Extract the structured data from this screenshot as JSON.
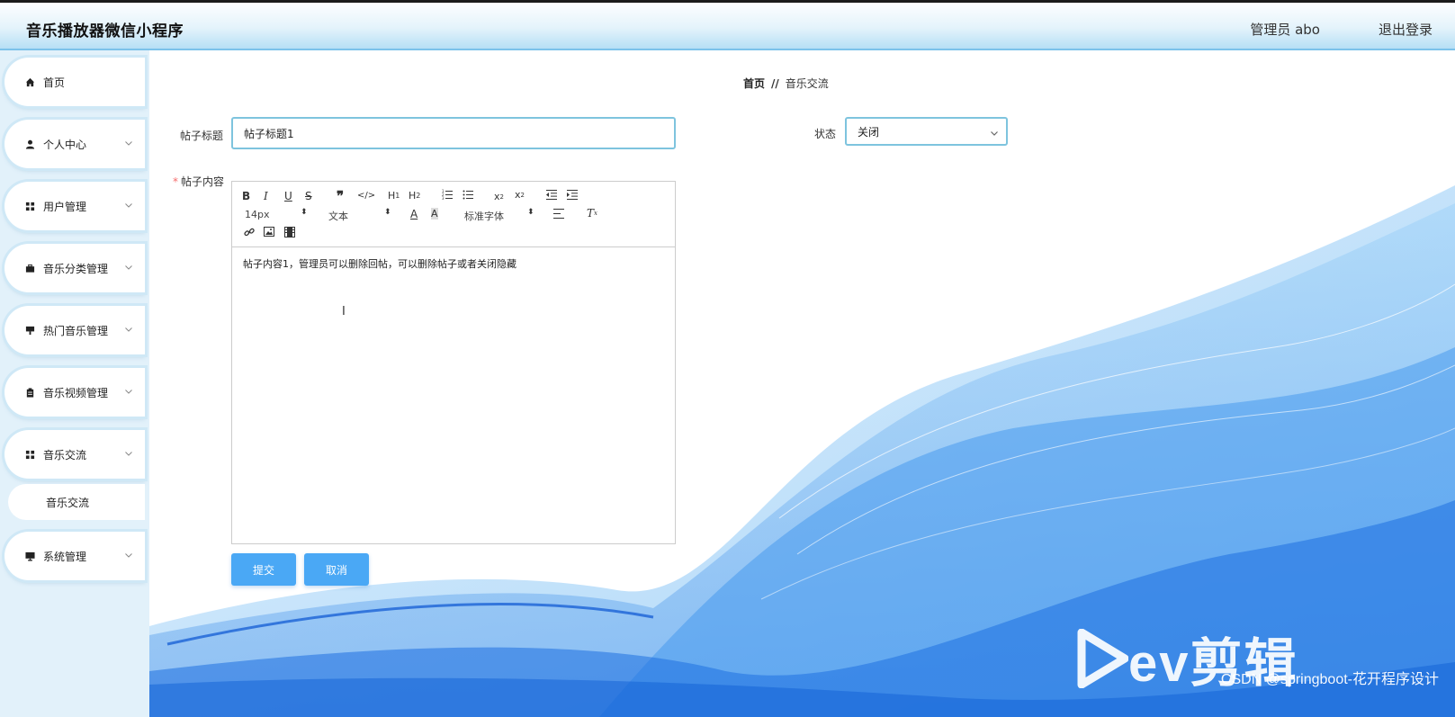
{
  "header": {
    "app_title": "音乐播放器微信小程序",
    "user_label": "管理员 abo",
    "logout_label": "退出登录"
  },
  "sidebar": {
    "items": [
      {
        "label": "首页",
        "icon": "home-icon"
      },
      {
        "label": "个人中心",
        "icon": "user-icon"
      },
      {
        "label": "用户管理",
        "icon": "grid-icon"
      },
      {
        "label": "音乐分类管理",
        "icon": "briefcase-icon"
      },
      {
        "label": "热门音乐管理",
        "icon": "flag-icon"
      },
      {
        "label": "音乐视频管理",
        "icon": "clipboard-icon"
      },
      {
        "label": "音乐交流",
        "icon": "grid-icon"
      },
      {
        "label": "系统管理",
        "icon": "monitor-icon"
      }
    ],
    "submenu_label": "音乐交流"
  },
  "breadcrumb": {
    "home": "首页",
    "separator": "//",
    "current": "音乐交流"
  },
  "form": {
    "title_label": "帖子标题",
    "title_value": "帖子标题1",
    "status_label": "状态",
    "status_value": "关闭",
    "content_label": "帖子内容",
    "content_value": "帖子内容1，管理员可以删除回帖，可以删除帖子或者关闭隐藏",
    "submit_label": "提交",
    "cancel_label": "取消"
  },
  "editor_toolbar": {
    "font_size": "14px",
    "header_select": "文本",
    "font_family": "标准字体"
  },
  "watermark": {
    "logo_text": "ev剪辑",
    "credit": "CSDN @springboot-花开程序设计"
  },
  "colors": {
    "accent": "#4aa8f5",
    "input_border": "#7ec4de",
    "sidebar_bg": "#e2f1fa"
  }
}
